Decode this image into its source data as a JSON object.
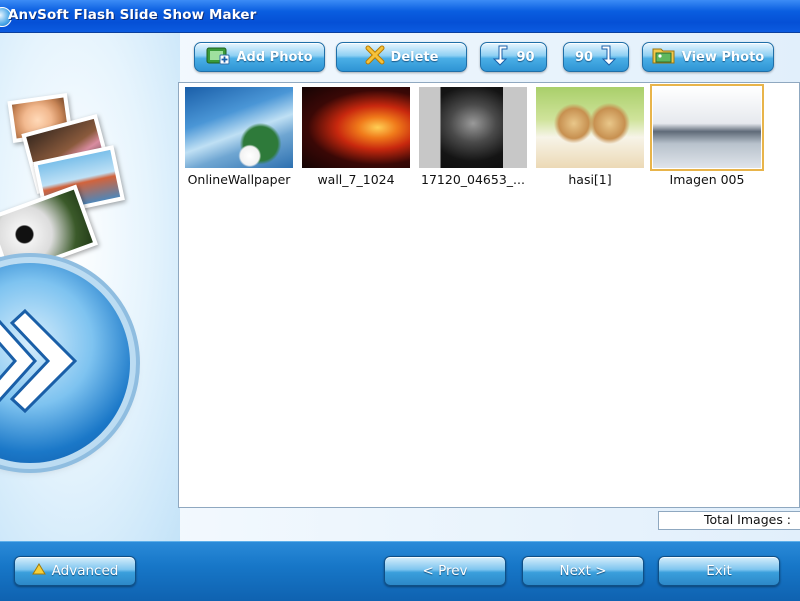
{
  "window": {
    "title": "AnvSoft Flash Slide Show Maker"
  },
  "toolbar": {
    "add_photo": {
      "label": "Add Photo",
      "icon": "add-photo-icon"
    },
    "delete": {
      "label": "Delete",
      "icon": "delete-x-icon"
    },
    "rotate_left": {
      "label": "90",
      "icon": "rotate-left-arrow-icon"
    },
    "rotate_right": {
      "label": "90",
      "icon": "rotate-right-arrow-icon"
    },
    "view_photo": {
      "label": "View Photo",
      "icon": "folder-photo-icon"
    }
  },
  "photos": [
    {
      "caption": "OnlineWallpaper",
      "selected": false
    },
    {
      "caption": "wall_7_1024",
      "selected": false
    },
    {
      "caption": "17120_04653_...",
      "selected": false
    },
    {
      "caption": "hasi[1]",
      "selected": false
    },
    {
      "caption": "Imagen 005",
      "selected": true
    }
  ],
  "status": {
    "total_images_label": "Total Images :"
  },
  "bottom": {
    "advanced": {
      "label": "Advanced",
      "icon": "up-triangle-icon"
    },
    "prev": {
      "label": "< Prev"
    },
    "next": {
      "label": "Next >"
    },
    "exit": {
      "label": "Exit"
    }
  },
  "colors": {
    "titlebar": "#0a5ee0",
    "button": "#4aaee6",
    "bottom_bar": "#1777c8",
    "selection": "#e8b44a"
  }
}
